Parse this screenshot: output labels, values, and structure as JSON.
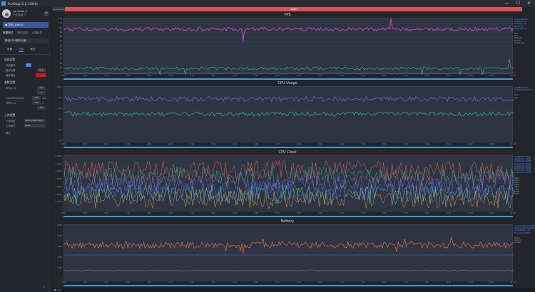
{
  "window": {
    "title": "PerfDog(v5.2.21040)",
    "minimize": "—",
    "maximize": "☐",
    "close": "✕"
  },
  "user": {
    "name": "sai Sable ◻",
    "subtitle": "专业版用户",
    "menu": "≡"
  },
  "device": {
    "label": "● 型机_ABKIA"
  },
  "top_tabs": [
    "数据测试",
    "测试记录",
    "云端记录"
  ],
  "section_btn": "降低CPU频率/功耗",
  "sub_tabs": [
    "设置",
    "性能",
    "其它"
  ],
  "groups": {
    "display": {
      "title": "信息设置",
      "items": [
        {
          "label": "开启悬浮",
          "value": "开"
        },
        {
          "label": "悬浮位置",
          "value": "左上"
        },
        {
          "label": "悬浮颜色",
          "value": ""
        }
      ]
    },
    "params": {
      "title": "参数设置",
      "items": [
        {
          "label": "FPS(1-1)",
          "value": "30"
        },
        {
          "label": "",
          "value": "5"
        },
        {
          "label": "FrameTime(1s)",
          "value": "100",
          "extra": "200"
        },
        {
          "label": "FPS(1-1)",
          "value": "30",
          "unit": "%"
        },
        {
          "label": "",
          "value": "60"
        }
      ]
    },
    "upload": {
      "title": "上传设置",
      "items": [
        {
          "label": "上传地址",
          "value": "https://perfdog.q"
        },
        {
          "label": "上传格式",
          "value": "JSON"
        }
      ]
    }
  },
  "reset_label": "默认",
  "collapse_icon": "«",
  "banner_text": "Label1",
  "corner_tab": "Screenshot",
  "footer_text": "■ 1/36",
  "time_ticks": [
    "0:00",
    "0:32",
    "1:04",
    "1:36",
    "2:08",
    "2:40",
    "3:12",
    "3:44",
    "4:16",
    "4:48",
    "5:20",
    "5:52",
    "6:24",
    "6:56",
    "7:28",
    "8:00",
    "8:32",
    "9:04",
    "9:36",
    "10:08",
    "10:40",
    "11:12"
  ],
  "charts": [
    {
      "id": "fps",
      "title": "FPS",
      "ylabels": [
        "120",
        "110",
        "100",
        "90",
        "80",
        "70",
        "60",
        "50",
        "40",
        "30",
        "20",
        "10",
        "0"
      ],
      "legend": [
        "Avg(FPS)[60.0]",
        "Var(FPS)[3.1]",
        "Stutter[1.2%]",
        "Jank[0.4]",
        "BigJank[0.1]"
      ],
      "legend_grey": [
        "FPS",
        "Jank",
        "BigJank",
        "Stutter",
        "InterFrame"
      ]
    },
    {
      "id": "cpu",
      "title": "CPU Usage",
      "ylabels": [
        "100%",
        "80%",
        "60%",
        "40%",
        "20%",
        "0%"
      ],
      "legend": [
        "AvgCPU[55.4%]",
        "AvgAppCPU[22.8%]"
      ],
      "legend_grey": [
        "CPU",
        "App"
      ]
    },
    {
      "id": "clock",
      "title": "CPU Clock",
      "ylabels": [
        "2.8GHz",
        "2.4GHz",
        "2.0GHz",
        "1.6GHz",
        "1.2GHz",
        "0.8GHz",
        "0.4GHz",
        "0"
      ],
      "legend": [
        "AvgCPU0[1.1GHz]",
        "AvgCPU1[1.1GHz]",
        "AvgCPU2[1.4GHz]",
        "AvgCPU3[1.4GHz]",
        "AvgCPU4[1.9GHz]",
        "AvgCPU5[1.9GHz]",
        "AvgCPU6[2.1GHz]",
        "AvgCPU7[2.0GHz]"
      ],
      "legend_grey": [
        "CPU0",
        "CPU1",
        "CPU2",
        "CPU3",
        "CPU4",
        "CPU5",
        "CPU6",
        "CPU7"
      ]
    },
    {
      "id": "battery",
      "title": "Battery",
      "ylabels": [
        "5000",
        "4000",
        "3000",
        "2000",
        "1000",
        "0"
      ],
      "legend": [
        "AvgPower[2456.3mW]",
        "AvgCurrent[570.2mA]",
        "AvgVoltage[4.3V]",
        "Energy[16.2mWh]"
      ],
      "legend_grey": [
        "Power",
        "Current",
        "Voltage"
      ]
    }
  ],
  "colors": {
    "fps": "#d254d8",
    "fps2": "#43c07a",
    "cpu": "#5a74e0",
    "cpu2": "#3fb08a",
    "battery": "#e56b55",
    "battery2": "#b450c8",
    "scroll": "#2da3e8"
  }
}
